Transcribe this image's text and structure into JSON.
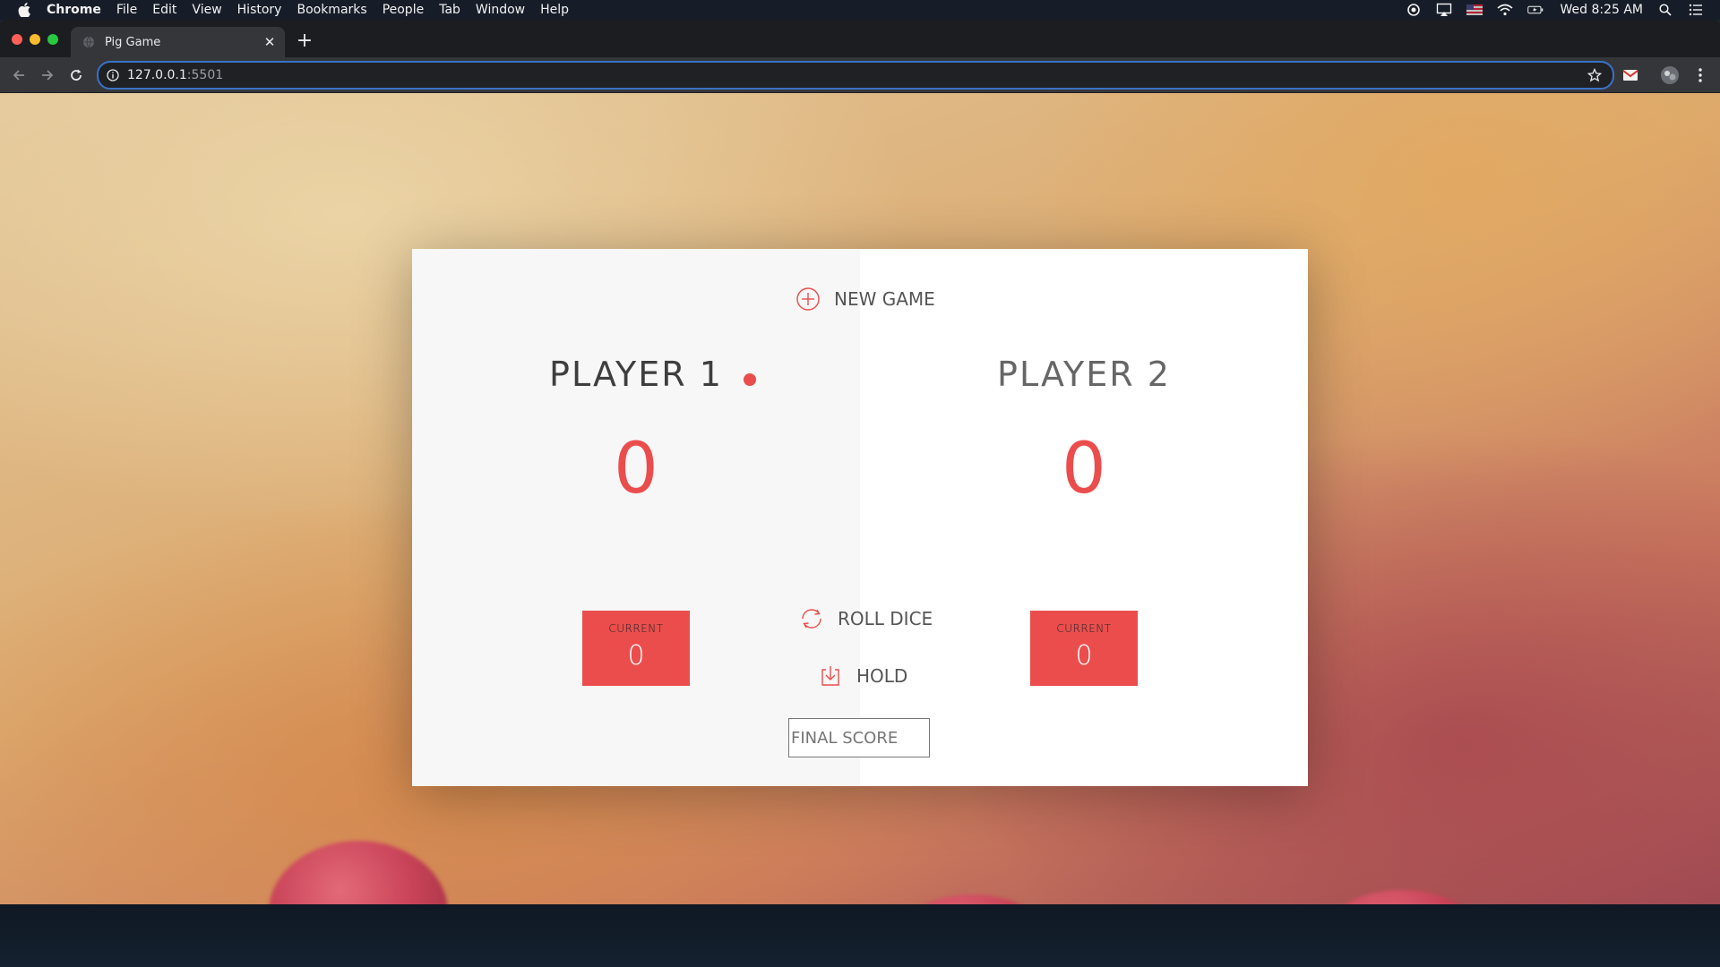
{
  "menubar": {
    "app_name": "Chrome",
    "items": [
      "File",
      "Edit",
      "View",
      "History",
      "Bookmarks",
      "People",
      "Tab",
      "Window",
      "Help"
    ],
    "clock": "Wed 8:25 AM"
  },
  "browser": {
    "tab_title": "Pig Game",
    "url_host": "127.0.0.1",
    "url_port": ":5501"
  },
  "game": {
    "new_game_label": "NEW GAME",
    "roll_dice_label": "ROLL DICE",
    "hold_label": "HOLD",
    "final_score_placeholder": "FINAL SCORE",
    "players": [
      {
        "name": "PLAYER 1",
        "score": "0",
        "current_label": "CURRENT",
        "current": "0",
        "active": true
      },
      {
        "name": "PLAYER 2",
        "score": "0",
        "current_label": "CURRENT",
        "current": "0",
        "active": false
      }
    ],
    "accent_color": "#eb4d4d"
  }
}
